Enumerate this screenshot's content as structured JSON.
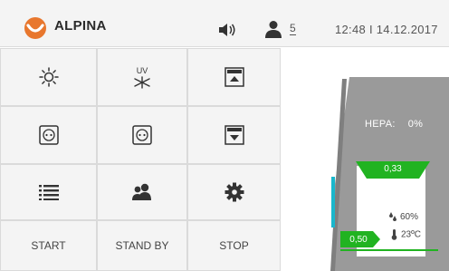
{
  "header": {
    "brand": "ALPINA",
    "user_count": "5",
    "clock": "12:48 I 14.12.2017",
    "logo_icon": "alpina-logo",
    "sound_icon": "speaker-icon",
    "user_icon": "user-icon"
  },
  "grid": {
    "buttons": [
      {
        "icon": "light-icon"
      },
      {
        "icon": "uv-lamp-icon",
        "text": "UV"
      },
      {
        "icon": "sash-up-icon"
      },
      {
        "icon": "socket-icon"
      },
      {
        "icon": "socket-icon"
      },
      {
        "icon": "sash-down-icon"
      },
      {
        "icon": "list-icon"
      },
      {
        "icon": "users-icon"
      },
      {
        "icon": "gear-icon"
      }
    ],
    "start_label": "START",
    "standby_label": "STAND BY",
    "stop_label": "STOP"
  },
  "status": {
    "hepa_label": "HEPA:",
    "hepa_value": "0%",
    "inflow_value": "0,33",
    "downflow_value": "0,50",
    "humidity": "60%",
    "temperature": "23ºC"
  },
  "colors": {
    "accent_orange": "#e8772e",
    "status_green": "#21b321",
    "indicator_cyan": "#1ab7cc",
    "cabinet_grey": "#9a9a9a",
    "tile_bg": "#f4f4f4"
  }
}
